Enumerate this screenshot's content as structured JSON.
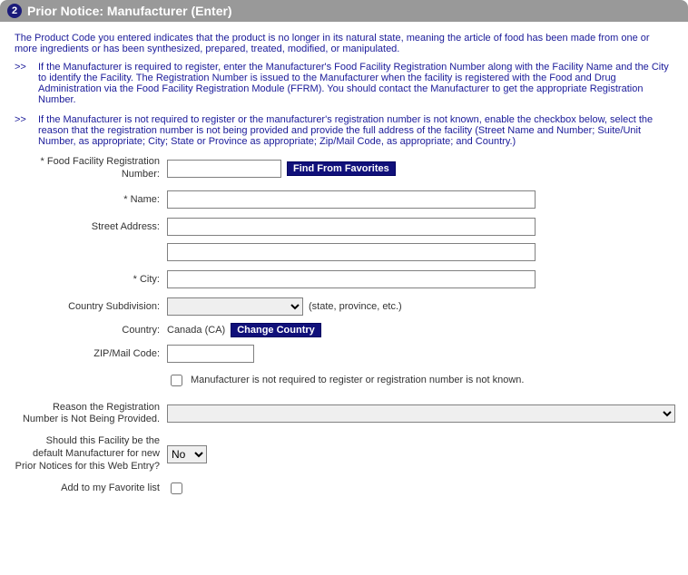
{
  "header": {
    "step": "2",
    "title": "Prior Notice: Manufacturer (Enter)"
  },
  "intro": "The Product Code you entered indicates that the product is no longer in its natural state, meaning the article of food has been made from one or more ingredients or has been synthesized, prepared, treated, modified, or manipulated.",
  "bullets": {
    "mark": ">>",
    "items": [
      "If the Manufacturer is required to register, enter the Manufacturer's Food Facility Registration Number along with the Facility Name and the City to identify the Facility. The Registration Number is issued to the Manufacturer when the facility is registered with the Food and Drug Administration via the Food Facility Registration Module (FFRM). You should contact the Manufacturer to get the appropriate Registration Number.",
      "If the Manufacturer is not required to register or the manufacturer's registration number is not known, enable the checkbox below, select the reason that the registration number is not being provided and provide the full address of the facility (Street Name and Number; Suite/Unit Number, as appropriate; City; State or Province as appropriate; Zip/Mail Code, as appropriate; and Country.)"
    ]
  },
  "form": {
    "reg_label": "* Food Facility Registration Number:",
    "reg_value": "",
    "find_favorites": "Find From Favorites",
    "name_label": "* Name:",
    "name_value": "",
    "street_label": "Street Address:",
    "street1": "",
    "street2": "",
    "city_label": "* City:",
    "city_value": "",
    "subdiv_label": "Country Subdivision:",
    "subdiv_value": "",
    "subdiv_hint": "(state, province, etc.)",
    "country_label": "Country:",
    "country_value": "Canada (CA)",
    "change_country": "Change Country",
    "zip_label": "ZIP/Mail Code:",
    "zip_value": "",
    "notrequired_label": "Manufacturer is not required to register or registration number is not known.",
    "reason_label": "Reason the Registration Number is Not Being Provided.",
    "reason_value": "",
    "default_label": "Should this Facility be the default Manufacturer for new Prior Notices for this Web Entry?",
    "default_value": "No",
    "favorite_label": "Add to my Favorite list"
  }
}
